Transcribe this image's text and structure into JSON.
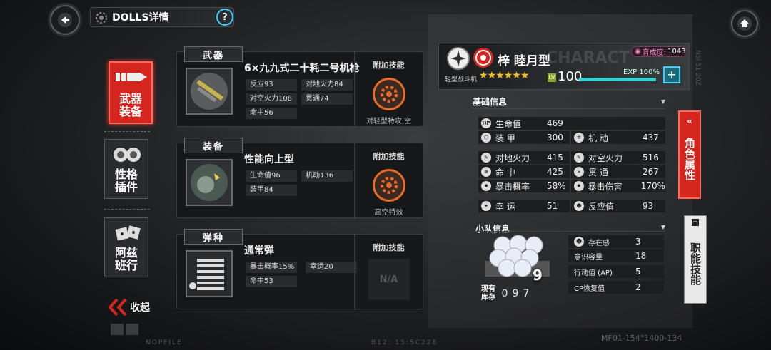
{
  "header": {
    "title": "DOLLS详情",
    "help": "?"
  },
  "side_tabs": [
    {
      "label1": "武器",
      "label2": "装备"
    },
    {
      "label1": "性格",
      "label2": "插件"
    },
    {
      "label1": "阿兹",
      "label2": "班行"
    }
  ],
  "collapse": "收起",
  "skill_header": "附加技能",
  "cards": [
    {
      "label": "武器",
      "name": "6×九九式二十耗二号机枪",
      "stats": [
        "反应93",
        "对地火力84",
        "对空火力108",
        "贯通74",
        "命中56"
      ],
      "skill_name": "对轻型特攻,空"
    },
    {
      "label": "装备",
      "name": "性能向上型",
      "stats": [
        "生命值96",
        "机动136",
        "装甲84"
      ],
      "skill_name": "高空特效"
    },
    {
      "label": "弹种",
      "name": "通常弹",
      "stats": [
        "暴击概率15%",
        "幸运20",
        "命中53"
      ],
      "skill_name": "N/A"
    }
  ],
  "character": {
    "name": "梓 睦月型",
    "class": "轻型战斗机",
    "level": "100",
    "exp": "EXP 100%",
    "exp_fraction": 1.0,
    "stars": 6,
    "growth_label": "育成度:",
    "growth": "1043",
    "watermark": "CHARACT"
  },
  "basic_info": {
    "title": "基础信息",
    "rows": [
      {
        "label": "生命值",
        "value": "469"
      },
      {
        "label": "装 甲",
        "value": "300"
      },
      {
        "label": "机 动",
        "value": "437"
      },
      {
        "label": "对地火力",
        "value": "415"
      },
      {
        "label": "对空火力",
        "value": "516"
      },
      {
        "label": "命 中",
        "value": "425"
      },
      {
        "label": "贯 通",
        "value": "267"
      },
      {
        "label": "暴击概率",
        "value": "58%"
      },
      {
        "label": "暴击伤害",
        "value": "170%"
      },
      {
        "label": "幸 运",
        "value": "51"
      },
      {
        "label": "反应值",
        "value": "93"
      }
    ]
  },
  "squad": {
    "title": "小队信息",
    "count": "9",
    "stock_label1": "现有",
    "stock_label2": "库存",
    "stock": [
      "0",
      "9",
      "7"
    ],
    "rows": [
      {
        "label": "存在感",
        "value": "3"
      },
      {
        "label": "意识容量",
        "value": "18"
      },
      {
        "label": "行动值 (AP)",
        "value": "5"
      },
      {
        "label": "CP恢复值",
        "value": "2"
      }
    ]
  },
  "right_tabs": [
    {
      "label": "角色属性"
    },
    {
      "label": "职能技能"
    }
  ],
  "footer": {
    "left": "NOPFILE",
    "mid": "B12:  15:SC228",
    "right": "MF01-154°1400-134"
  }
}
